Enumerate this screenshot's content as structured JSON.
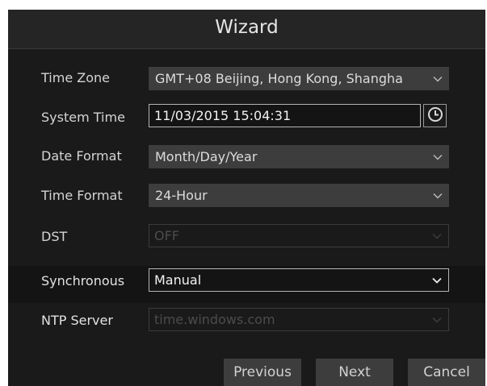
{
  "window": {
    "title": "Wizard"
  },
  "form": {
    "time_zone": {
      "label": "Time Zone",
      "value": "GMT+08 Beijing, Hong Kong, Shangha"
    },
    "system_time": {
      "label": "System Time",
      "value": "11/03/2015 15:04:31"
    },
    "date_format": {
      "label": "Date Format",
      "value": "Month/Day/Year"
    },
    "time_format": {
      "label": "Time Format",
      "value": "24-Hour"
    },
    "dst": {
      "label": "DST",
      "value": "OFF"
    },
    "synchronous": {
      "label": "Synchronous",
      "value": "Manual"
    },
    "ntp_server": {
      "label": "NTP Server",
      "value": "time.windows.com"
    }
  },
  "buttons": {
    "previous": "Previous",
    "next": "Next",
    "cancel": "Cancel"
  },
  "icons": {
    "clock": "clock-icon",
    "dropdown": "chevron-down-icon"
  },
  "colors": {
    "background": "#1a1a1a",
    "field": "#3d3d3d",
    "text": "#d4d4d4",
    "disabled_text": "#4c4c4c"
  }
}
